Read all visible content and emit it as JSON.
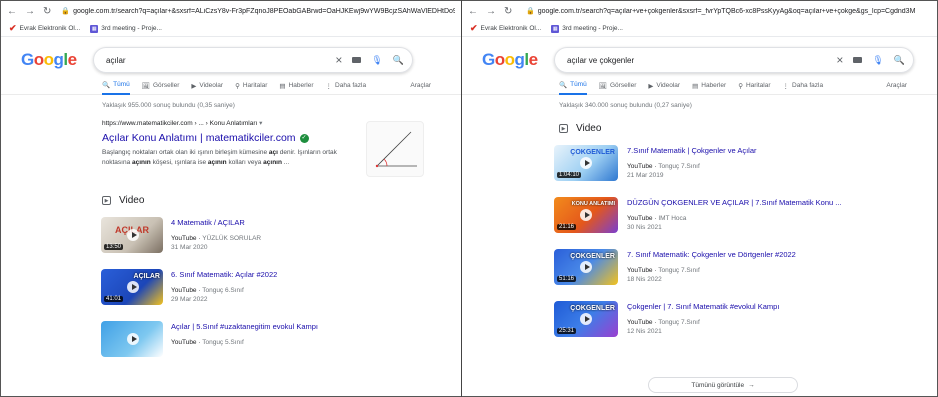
{
  "left": {
    "browser": {
      "url": "google.com.tr/search?q=açılar+&sxsrf=ALiCzsY8v-Fr3pFZqnoJ8PEOabGABrwd=OaHJKEwj9wYW9BcjzSAhWaVlEDHtDo9gMQ4dU",
      "bookmarks": [
        "Evrak Elektronik Ol...",
        "3rd meeting - Proje..."
      ]
    },
    "search": {
      "query": "açılar"
    },
    "tabs": [
      "Tümü",
      "Görseller",
      "Videolar",
      "Haritalar",
      "Haberler",
      "Daha fazla",
      "Araçlar"
    ],
    "stats": "Yaklaşık 955.000 sonuç bulundu (0,35 saniye)",
    "result": {
      "crumb": "https://www.matematikciler.com › ... › Konu Anlatımları",
      "crumb_more": "▾",
      "title": "Açılar Konu Anlatımı | matematikciler.com",
      "snippet_a": "Başlangıç noktaları ortak olan iki ışının birleşim kümesine ",
      "snippet_b1": "açı",
      "snippet_c": " denir. Işınların ortak noktasına ",
      "snippet_b2": "açının",
      "snippet_d": " köşesi, ışınlara ise ",
      "snippet_b3": "açının",
      "snippet_e": " kolları veya ",
      "snippet_b4": "açının",
      "snippet_f": " ..."
    },
    "video_heading": "Video",
    "videos": [
      {
        "title": "4 Matematik / AÇILAR",
        "source": "YouTube",
        "channel": "YÜZLÜK SORULAR",
        "date": "31 Mar 2020",
        "duration": "13:50",
        "caption": "AÇILAR"
      },
      {
        "title": "6. Sınıf Matematik: Açılar #2022",
        "source": "YouTube",
        "channel": "Tonguç 6.Sınıf",
        "date": "29 Mar 2022",
        "duration": "41:01",
        "caption": "AÇILAR"
      },
      {
        "title": "Açılar | 5.Sınıf #uzaktanegitim evokul Kampı",
        "source": "YouTube",
        "channel": "Tonguç 5.Sınıf",
        "date": "",
        "duration": "",
        "caption": ""
      }
    ]
  },
  "right": {
    "browser": {
      "url": "google.com.tr/search?q=açılar+ve+çokgenler&sxsrf=_fvrYpTQBc6-xc8PssKyyAg&oq=açılar+ve+çokge&gs_lcp=Cgdnd3M",
      "bookmarks": [
        "Evrak Elektronik Ol...",
        "3rd meeting - Proje..."
      ]
    },
    "search": {
      "query": "açılar ve çokgenler"
    },
    "tabs": [
      "Tümü",
      "Görseller",
      "Videolar",
      "Haberler",
      "Haritalar",
      "Daha fazla",
      "Araçlar"
    ],
    "stats": "Yaklaşık 340.000 sonuç bulundu (0,27 saniye)",
    "video_heading": "Video",
    "videos": [
      {
        "title": "7.Sınıf Matematik | Çokgenler ve Açılar",
        "source": "YouTube",
        "channel": "Tonguç 7.Sınıf",
        "date": "21 Mar 2019",
        "duration": "1:04:10",
        "caption": "ÇOKGENLER"
      },
      {
        "title": "DÜZGÜN ÇOKGENLER VE AÇILAR | 7.Sınıf Matematik Konu ...",
        "source": "YouTube",
        "channel": "IMT Hoca",
        "date": "30 Nis 2021",
        "duration": "21:16",
        "caption": "KONU ANLATIMI"
      },
      {
        "title": "7. Sınıf Matematik: Çokgenler ve Dörtgenler #2022",
        "source": "YouTube",
        "channel": "Tonguç 7.Sınıf",
        "date": "18 Nis 2022",
        "duration": "51:16",
        "caption": "ÇOKGENLER"
      },
      {
        "title": "Çokgenler | 7. Sınıf Matematik #evokul Kampı",
        "source": "YouTube",
        "channel": "Tonguç 7.Sınıf",
        "date": "12 Nis 2021",
        "duration": "25:31",
        "caption": "ÇOKGENLER"
      }
    ],
    "show_all": "Tümünü görüntüle",
    "show_all_arrow": "→"
  },
  "colors": {
    "link": "#1a0dab",
    "accent": "#1a73e8",
    "thumb_yellow": "#f4c21c",
    "thumb_blue": "#1f5bd6",
    "thumb_orange": "#f28b1c"
  }
}
